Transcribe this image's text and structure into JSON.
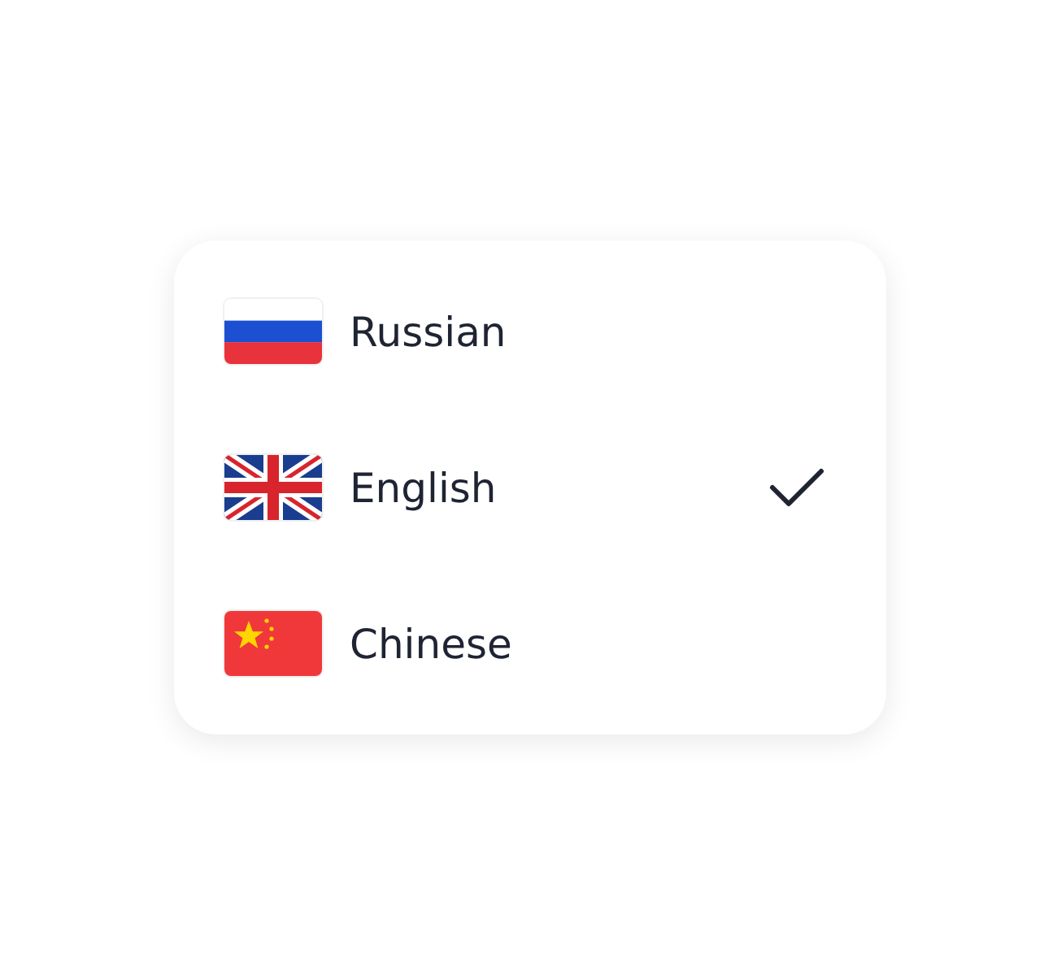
{
  "languages": [
    {
      "label": "Russian",
      "kind": "ru",
      "selected": false
    },
    {
      "label": "English",
      "kind": "gb",
      "selected": true
    },
    {
      "label": "Chinese",
      "kind": "cn",
      "selected": false
    }
  ]
}
